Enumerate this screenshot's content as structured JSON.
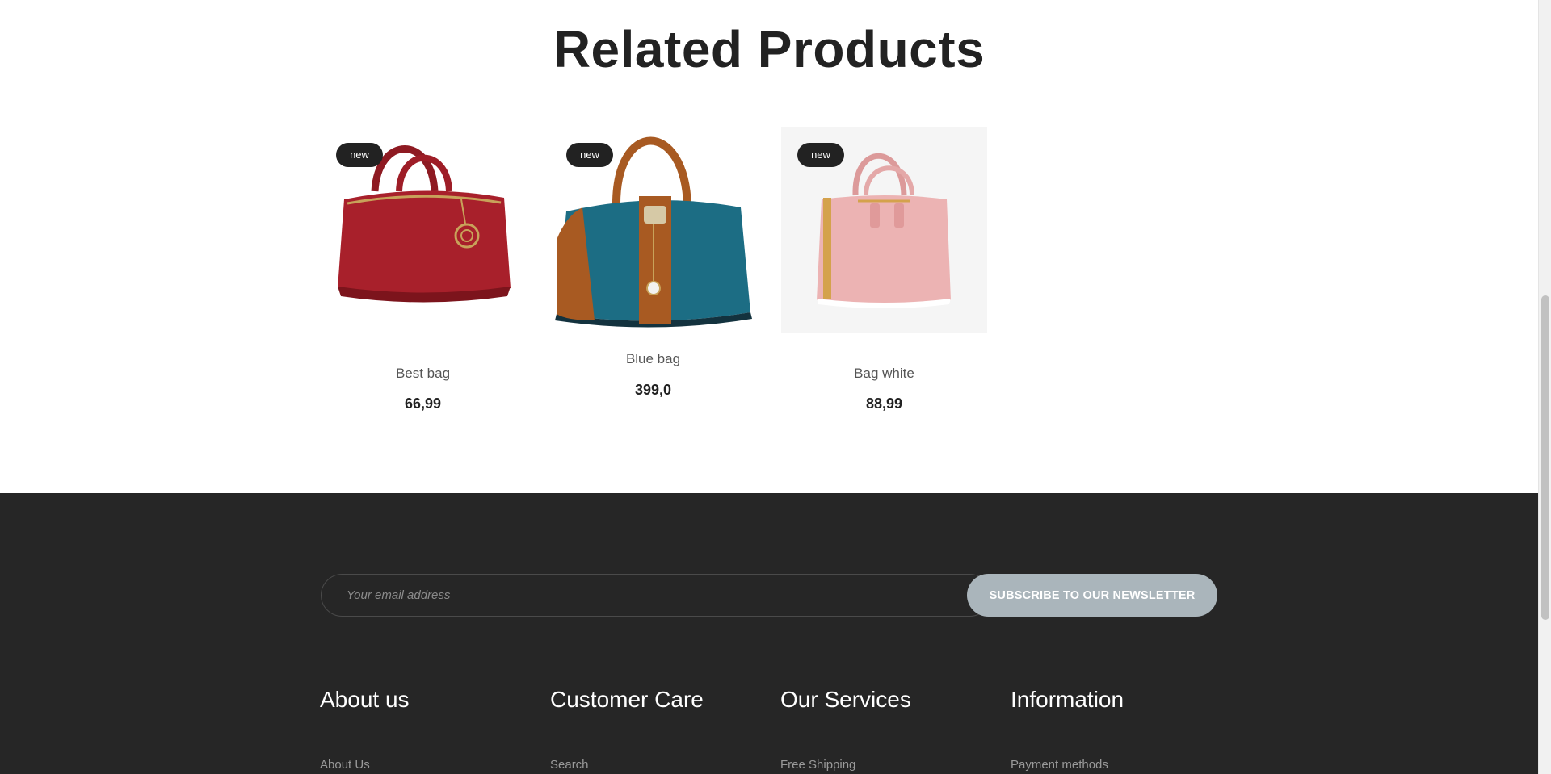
{
  "related": {
    "title": "Related Products",
    "products": [
      {
        "name": "Best bag",
        "price": "66,99",
        "badge": "new",
        "color": "#a8202b"
      },
      {
        "name": "Blue bag",
        "price": "399,0",
        "badge": "new",
        "color": "#1c6d84"
      },
      {
        "name": "Bag white",
        "price": "88,99",
        "badge": "new",
        "color": "#ecb3b3"
      }
    ]
  },
  "newsletter": {
    "placeholder": "Your email address",
    "button_label": "SUBSCRIBE TO OUR NEWSLETTER"
  },
  "footer": {
    "columns": [
      {
        "heading": "About us",
        "first_link": "About Us"
      },
      {
        "heading": "Customer Care",
        "first_link": "Search"
      },
      {
        "heading": "Our Services",
        "first_link": "Free Shipping"
      },
      {
        "heading": "Information",
        "first_link": "Payment methods"
      }
    ]
  },
  "colors": {
    "footer_bg": "#262626",
    "badge_bg": "#222222",
    "subscribe_bg": "#aab5bb"
  }
}
